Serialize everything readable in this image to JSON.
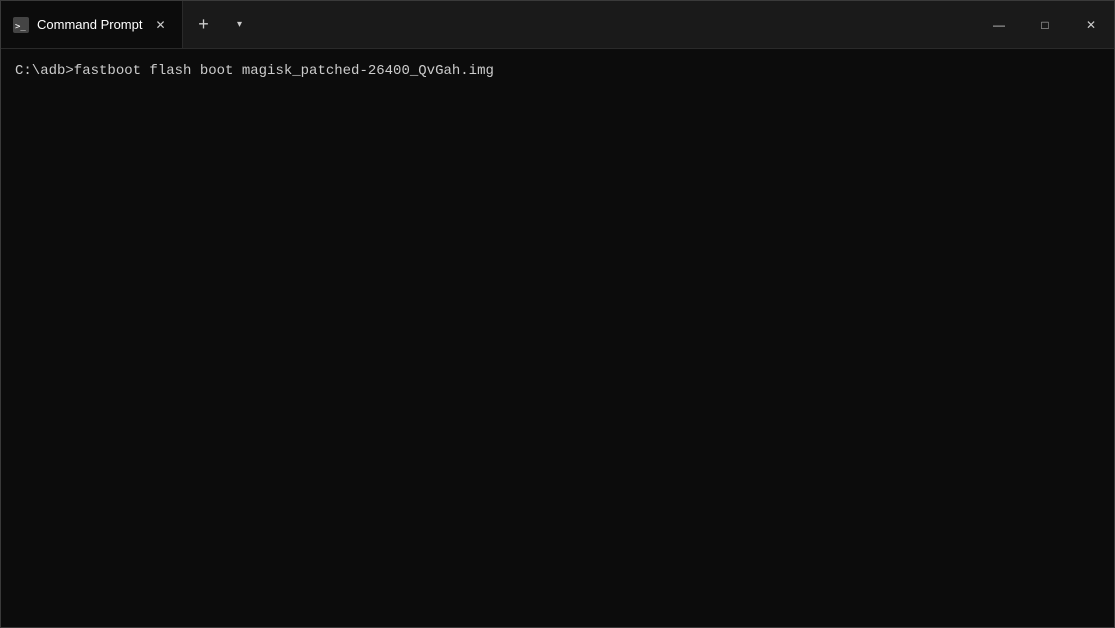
{
  "window": {
    "title": "Command Prompt"
  },
  "titlebar": {
    "tab_label": "Command Prompt",
    "new_tab_symbol": "+",
    "dropdown_symbol": "▾",
    "minimize_symbol": "—",
    "maximize_symbol": "□",
    "close_symbol": "✕"
  },
  "terminal": {
    "line1": "C:\\adb>fastboot flash boot magisk_patched-26400_QvGah.img"
  }
}
